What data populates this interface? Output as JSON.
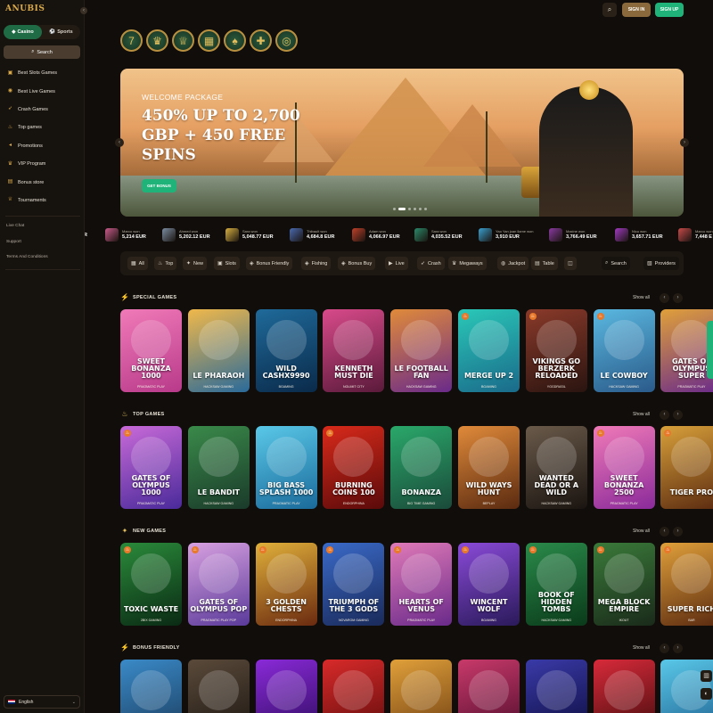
{
  "brand": {
    "logo": "ANUBIS"
  },
  "sidebar": {
    "modes": [
      {
        "label": "Casino",
        "active": true
      },
      {
        "label": "Sports",
        "active": false
      }
    ],
    "search_label": "Search",
    "items": [
      {
        "label": "Best Slots Games",
        "icon": "slot-icon"
      },
      {
        "label": "Best Live Games",
        "icon": "live-icon"
      },
      {
        "label": "Crash Games",
        "icon": "rocket-icon"
      },
      {
        "label": "Top games",
        "icon": "flame-icon"
      },
      {
        "label": "Promotions",
        "icon": "megaphone-icon"
      },
      {
        "label": "VIP Program",
        "icon": "crown-icon"
      },
      {
        "label": "Bonus store",
        "icon": "store-icon"
      },
      {
        "label": "Tournaments",
        "icon": "trophy-icon"
      }
    ],
    "links": [
      "Live Chat",
      "Support",
      "Terms And Conditions"
    ],
    "language": "English"
  },
  "topbar": {
    "signin": "SIGN IN",
    "signup": "SIGN UP"
  },
  "quick_icons": [
    "seven-icon",
    "crown-icon",
    "trophy-icon",
    "cash-icon",
    "spade-icon",
    "gift-icon",
    "chip-icon"
  ],
  "banner": {
    "kicker": "WELCOME PACKAGE",
    "title": "450% UP TO 2,700 GBP + 450 FREE SPINS",
    "cta": "GET BONUS",
    "slides": 6,
    "active_slide": 1
  },
  "winners": [
    {
      "name": "",
      "amount": "UR",
      "color": "#6b4a2a"
    },
    {
      "name": "Marco won",
      "amount": "5,214 EUR",
      "color": "#c95a8a"
    },
    {
      "name": "Ahmed won",
      "amount": "5,202.12 EUR",
      "color": "#7a8ca0"
    },
    {
      "name": "Sara won",
      "amount": "5,048.77 EUR",
      "color": "#d8b040"
    },
    {
      "name": "Thibault won",
      "amount": "4,684.8 EUR",
      "color": "#4a6ab0"
    },
    {
      "name": "Adam won",
      "amount": "4,066.97 EUR",
      "color": "#c0402a"
    },
    {
      "name": "Sara won",
      "amount": "4,035.52 EUR",
      "color": "#2a8a6a"
    },
    {
      "name": "Yao Yan joan llame won",
      "amount": "3,910 EUR",
      "color": "#3aa0d0"
    },
    {
      "name": "Maxine won",
      "amount": "3,766.49 EUR",
      "color": "#8a3aa0"
    },
    {
      "name": "Nicu won",
      "amount": "3,657.71 EUR",
      "color": "#a03ac0"
    },
    {
      "name": "Marco won",
      "amount": "7,448 E",
      "color": "#c84a4a"
    }
  ],
  "filters": [
    {
      "label": "All",
      "icon": "grid-icon"
    },
    {
      "label": "Top",
      "icon": "flame-icon"
    },
    {
      "label": "New",
      "icon": "new-icon"
    },
    {
      "label": "Slots",
      "icon": "slot-icon"
    },
    {
      "label": "Bonus Friendly",
      "icon": "gamepad-icon"
    },
    {
      "label": "Fishing",
      "icon": "gamepad-icon"
    },
    {
      "label": "Bonus Buy",
      "icon": "gamepad-icon"
    },
    {
      "label": "Live",
      "icon": "play-icon"
    },
    {
      "label": "Crash",
      "icon": "rocket-icon"
    },
    {
      "label": "Megaways",
      "icon": "crown-icon"
    },
    {
      "label": "Jackpot",
      "icon": "jackpot-icon"
    },
    {
      "label": "Table",
      "icon": "table-icon"
    },
    {
      "label": "",
      "icon": "more-icon"
    },
    {
      "label": "Search",
      "icon": "search-icon"
    },
    {
      "label": "Providers",
      "icon": "providers-icon"
    }
  ],
  "sections": [
    {
      "title": "SPECIAL GAMES",
      "icon": "lightning-icon",
      "show_all": "Show all",
      "games": [
        {
          "name": "SWEET BONANZA 1000",
          "provider": "PRAGMATIC PLAY",
          "c1": "#f07ab8",
          "c2": "#b83a8a",
          "badge": false
        },
        {
          "name": "LE PHARAOH",
          "provider": "HACKSAW GAMING",
          "c1": "#f0b84a",
          "c2": "#2a6a9a",
          "badge": false
        },
        {
          "name": "WILD CASHX9990",
          "provider": "BGAMING",
          "c1": "#1f6a9a",
          "c2": "#0a2a4a",
          "badge": false
        },
        {
          "name": "KENNETH MUST DIE",
          "provider": "NOLIMIT CITY",
          "c1": "#d84a8a",
          "c2": "#5a1a3a",
          "badge": false
        },
        {
          "name": "LE FOOTBALL FAN",
          "provider": "HACKSAW GAMING",
          "c1": "#e08a3a",
          "c2": "#6a2a8a",
          "badge": false
        },
        {
          "name": "MERGE UP 2",
          "provider": "BGAMING",
          "c1": "#2ac8b8",
          "c2": "#1a6a8a",
          "badge": true
        },
        {
          "name": "VIKINGS GO BERZERK RELOADED",
          "provider": "YGGDRASIL",
          "c1": "#8a3a2a",
          "c2": "#2a1410",
          "badge": true
        },
        {
          "name": "LE COWBOY",
          "provider": "HACKSAW GAMING",
          "c1": "#5ab8e0",
          "c2": "#2a5a8a",
          "badge": true
        },
        {
          "name": "GATES OF OLYMPUS SUPER",
          "provider": "PRAGMATIC PLAY",
          "c1": "#e0a03a",
          "c2": "#6a2a8a",
          "badge": false
        }
      ]
    },
    {
      "title": "TOP GAMES",
      "icon": "flame-icon",
      "show_all": "Show all",
      "games": [
        {
          "name": "GATES OF OLYMPUS 1000",
          "provider": "PRAGMATIC PLAY",
          "c1": "#c86ad8",
          "c2": "#4a2a9a",
          "badge": true
        },
        {
          "name": "LE BANDIT",
          "provider": "HACKSAW GAMING",
          "c1": "#3a8a4a",
          "c2": "#1a3a2a",
          "badge": false
        },
        {
          "name": "BIG BASS SPLASH 1000",
          "provider": "PRAGMATIC PLAY",
          "c1": "#5ac8e8",
          "c2": "#1a6a9a",
          "badge": false
        },
        {
          "name": "BURNING COINS 100",
          "provider": "ENDORPHINA",
          "c1": "#d82a1a",
          "c2": "#5a0a0a",
          "badge": true
        },
        {
          "name": "BONANZA",
          "provider": "BIG TIME GAMING",
          "c1": "#2aa86a",
          "c2": "#1a4a3a",
          "badge": false
        },
        {
          "name": "WILD WAYS HUNT",
          "provider": "BEPLAY",
          "c1": "#e08a3a",
          "c2": "#5a2a10",
          "badge": false
        },
        {
          "name": "WANTED DEAD OR A WILD",
          "provider": "HACKSAW GAMING",
          "c1": "#6a5a4a",
          "c2": "#1a1410",
          "badge": false
        },
        {
          "name": "SWEET BONANZA 2500",
          "provider": "PRAGMATIC PLAY",
          "c1": "#f07ab8",
          "c2": "#8a2a9a",
          "badge": true
        },
        {
          "name": "TIGER PRO",
          "provider": "",
          "c1": "#d8a03a",
          "c2": "#5a2a10",
          "badge": true
        }
      ]
    },
    {
      "title": "NEW GAMES",
      "icon": "new-icon",
      "show_all": "Show all",
      "games": [
        {
          "name": "TOXIC WASTE",
          "provider": "2BIX GAMING",
          "c1": "#2a8a3a",
          "c2": "#0a2a14",
          "badge": true
        },
        {
          "name": "GATES OF OLYMPUS POP",
          "provider": "PRAGMATIC PLAY POP",
          "c1": "#d8a0e0",
          "c2": "#5a3a9a",
          "badge": true
        },
        {
          "name": "3 GOLDEN CHESTS",
          "provider": "ENDORPHINA",
          "c1": "#e0b03a",
          "c2": "#6a2a10",
          "badge": true
        },
        {
          "name": "TRIUMPH OF THE 3 GODS",
          "provider": "NOVAROM GAMING",
          "c1": "#3a6ac8",
          "c2": "#1a2a5a",
          "badge": true
        },
        {
          "name": "HEARTS OF VENUS",
          "provider": "PRAGMATIC PLAY",
          "c1": "#e07ab8",
          "c2": "#6a2a8a",
          "badge": true
        },
        {
          "name": "WINCENT WOLF",
          "provider": "BGAMING",
          "c1": "#8a4ad8",
          "c2": "#2a1a5a",
          "badge": true
        },
        {
          "name": "BOOK OF HIDDEN TOMBS",
          "provider": "HACKSAW GAMING",
          "c1": "#2a8a4a",
          "c2": "#0a3a1a",
          "badge": true
        },
        {
          "name": "MEGA BLOCK EMPIRE",
          "provider": "IKOUT",
          "c1": "#3a7a3a",
          "c2": "#1a2a1a",
          "badge": true
        },
        {
          "name": "SUPER RICH",
          "provider": "BAR",
          "c1": "#e0a03a",
          "c2": "#5a2a10",
          "badge": true
        }
      ]
    },
    {
      "title": "BONUS FRIENDLY",
      "icon": "lightning-icon",
      "show_all": "Show all",
      "games": [
        {
          "name": "",
          "provider": "",
          "c1": "#3a8ac8",
          "c2": "#1a3a5a",
          "badge": false
        },
        {
          "name": "",
          "provider": "",
          "c1": "#5a4a3a",
          "c2": "#1a1410",
          "badge": false
        },
        {
          "name": "",
          "provider": "",
          "c1": "#8a2ad8",
          "c2": "#2a0a5a",
          "badge": false
        },
        {
          "name": "",
          "provider": "",
          "c1": "#d82a2a",
          "c2": "#5a0a0a",
          "badge": false
        },
        {
          "name": "",
          "provider": "",
          "c1": "#e0a03a",
          "c2": "#6a3a10",
          "badge": false
        },
        {
          "name": "",
          "provider": "",
          "c1": "#c83a6a",
          "c2": "#4a0a2a",
          "badge": false
        },
        {
          "name": "",
          "provider": "",
          "c1": "#3a3aa8",
          "c2": "#0a0a3a",
          "badge": false
        },
        {
          "name": "",
          "provider": "",
          "c1": "#d82a3a",
          "c2": "#3a0a0a",
          "badge": false
        },
        {
          "name": "",
          "provider": "",
          "c1": "#5ac8e8",
          "c2": "#1a5a8a",
          "badge": false
        }
      ]
    }
  ]
}
